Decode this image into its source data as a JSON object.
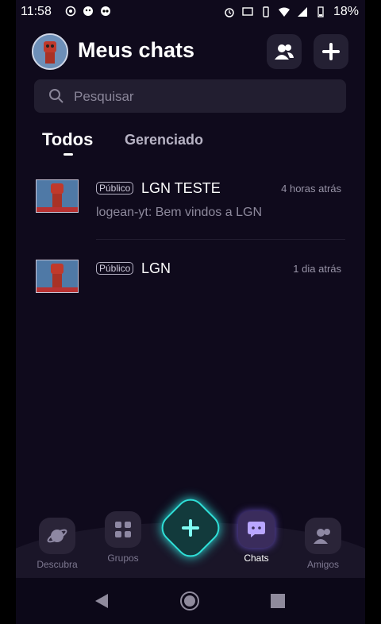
{
  "status_bar": {
    "time": "11:58",
    "battery": "18%"
  },
  "header": {
    "title": "Meus chats"
  },
  "search": {
    "placeholder": "Pesquisar"
  },
  "tabs": [
    {
      "label": "Todos",
      "active": true
    },
    {
      "label": "Gerenciado",
      "active": false
    }
  ],
  "chats": [
    {
      "badge": "Público",
      "name": "LGN TESTE",
      "time": "4 horas atrás",
      "last_message": "logean-yt: Bem vindos a LGN"
    },
    {
      "badge": "Público",
      "name": "LGN",
      "time": "1 dia atrás",
      "last_message": ""
    }
  ],
  "bottom_nav": [
    {
      "label": "Descubra",
      "icon": "planet-icon"
    },
    {
      "label": "Grupos",
      "icon": "grid-icon"
    },
    {
      "label": "Chats",
      "icon": "chat-icon",
      "active": true
    },
    {
      "label": "Amigos",
      "icon": "friends-icon"
    }
  ],
  "colors": {
    "background": "#0f0a1c",
    "accent": "#2fe0d8",
    "chat_active": "#8b6cff"
  }
}
